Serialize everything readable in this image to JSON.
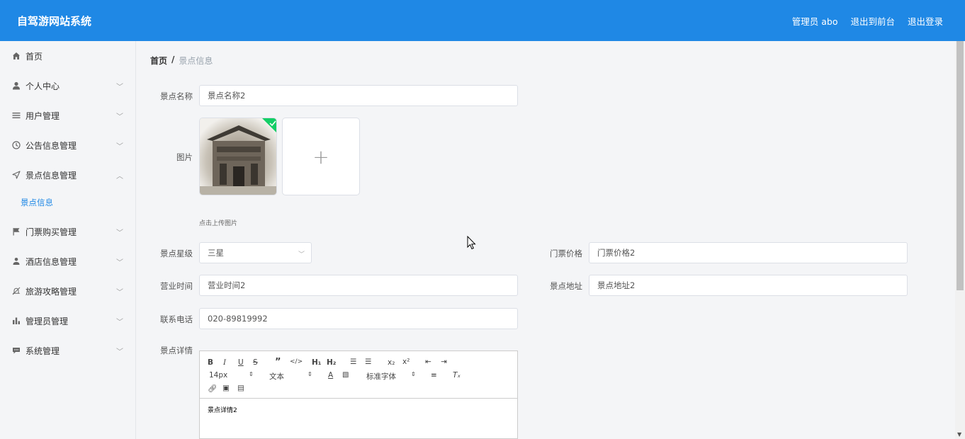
{
  "header": {
    "title": "自驾游网站系统",
    "admin_label": "管理员 abo",
    "to_front": "退出到前台",
    "logout": "退出登录"
  },
  "sidebar": {
    "items": [
      {
        "label": "首页",
        "icon": "home-icon"
      },
      {
        "label": "个人中心",
        "icon": "user-icon"
      },
      {
        "label": "用户管理",
        "icon": "list-icon"
      },
      {
        "label": "公告信息管理",
        "icon": "clock-icon"
      },
      {
        "label": "景点信息管理",
        "icon": "navigation-icon"
      },
      {
        "label": "门票购买管理",
        "icon": "flag-icon"
      },
      {
        "label": "酒店信息管理",
        "icon": "person-icon"
      },
      {
        "label": "旅游攻略管理",
        "icon": "bell-off-icon"
      },
      {
        "label": "管理员管理",
        "icon": "bar-chart-icon"
      },
      {
        "label": "系统管理",
        "icon": "chat-icon"
      }
    ],
    "subitem": "景点信息"
  },
  "breadcrumb": {
    "home": "首页",
    "sep": "/",
    "current": "景点信息"
  },
  "form": {
    "name_label": "景点名称",
    "name_value": "景点名称2",
    "image_label": "图片",
    "upload_hint": "点击上传图片",
    "star_label": "景点星级",
    "star_value": "三星",
    "price_label": "门票价格",
    "price_value": "门票价格2",
    "hours_label": "营业时间",
    "hours_value": "营业时间2",
    "address_label": "景点地址",
    "address_value": "景点地址2",
    "phone_label": "联系电话",
    "phone_value": "020-89819992",
    "detail_label": "景点详情"
  },
  "editor": {
    "font_size": "14px",
    "header_select": "文本",
    "font_family": "标准字体",
    "content": "景点详情2"
  },
  "colors": {
    "primary": "#1f88e5",
    "success": "#13ce66"
  }
}
